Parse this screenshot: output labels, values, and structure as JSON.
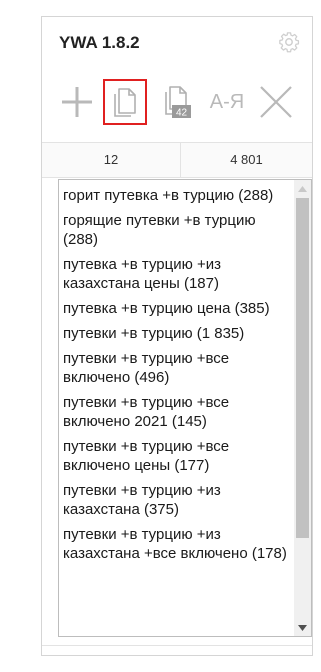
{
  "app": {
    "title": "YWA 1.8.2"
  },
  "toolbar": {
    "tools": [
      {
        "name": "add",
        "icon": "plus-icon"
      },
      {
        "name": "copy",
        "icon": "copy-pages-icon",
        "active": true
      },
      {
        "name": "copy-with-count",
        "icon": "copy-count-icon",
        "badge": "42"
      },
      {
        "name": "sort",
        "icon": "sort-az-icon",
        "label": "A-Я"
      },
      {
        "name": "clear",
        "icon": "close-icon"
      }
    ]
  },
  "counts": {
    "left": "12",
    "right": "4 801"
  },
  "list": {
    "items": [
      "горит путевка +в турцию (288)",
      "горящие путевки +в турцию (288)",
      "путевка +в турцию +из казахстана цены (187)",
      "путевка +в турцию цена (385)",
      "путевки +в турцию (1 835)",
      "путевки +в турцию +все включено (496)",
      "путевки +в турцию +все включено 2021 (145)",
      "путевки +в турцию +все включено цены (177)",
      "путевки +в турцию +из казахстана (375)",
      "путевки +в турцию +из казахстана +все включено (178)"
    ]
  },
  "colors": {
    "active_border": "#e02020",
    "icon": "#b9b9b9",
    "scroll_thumb": "#c1c1c1"
  }
}
